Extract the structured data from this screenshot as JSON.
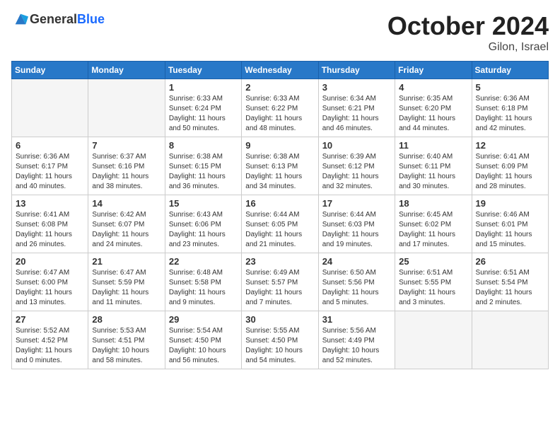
{
  "logo": {
    "general": "General",
    "blue": "Blue"
  },
  "title": "October 2024",
  "location": "Gilon, Israel",
  "days_of_week": [
    "Sunday",
    "Monday",
    "Tuesday",
    "Wednesday",
    "Thursday",
    "Friday",
    "Saturday"
  ],
  "weeks": [
    [
      {
        "day": "",
        "info": ""
      },
      {
        "day": "",
        "info": ""
      },
      {
        "day": "1",
        "sunrise": "6:33 AM",
        "sunset": "6:24 PM",
        "daylight": "11 hours and 50 minutes."
      },
      {
        "day": "2",
        "sunrise": "6:33 AM",
        "sunset": "6:22 PM",
        "daylight": "11 hours and 48 minutes."
      },
      {
        "day": "3",
        "sunrise": "6:34 AM",
        "sunset": "6:21 PM",
        "daylight": "11 hours and 46 minutes."
      },
      {
        "day": "4",
        "sunrise": "6:35 AM",
        "sunset": "6:20 PM",
        "daylight": "11 hours and 44 minutes."
      },
      {
        "day": "5",
        "sunrise": "6:36 AM",
        "sunset": "6:18 PM",
        "daylight": "11 hours and 42 minutes."
      }
    ],
    [
      {
        "day": "6",
        "sunrise": "6:36 AM",
        "sunset": "6:17 PM",
        "daylight": "11 hours and 40 minutes."
      },
      {
        "day": "7",
        "sunrise": "6:37 AM",
        "sunset": "6:16 PM",
        "daylight": "11 hours and 38 minutes."
      },
      {
        "day": "8",
        "sunrise": "6:38 AM",
        "sunset": "6:15 PM",
        "daylight": "11 hours and 36 minutes."
      },
      {
        "day": "9",
        "sunrise": "6:38 AM",
        "sunset": "6:13 PM",
        "daylight": "11 hours and 34 minutes."
      },
      {
        "day": "10",
        "sunrise": "6:39 AM",
        "sunset": "6:12 PM",
        "daylight": "11 hours and 32 minutes."
      },
      {
        "day": "11",
        "sunrise": "6:40 AM",
        "sunset": "6:11 PM",
        "daylight": "11 hours and 30 minutes."
      },
      {
        "day": "12",
        "sunrise": "6:41 AM",
        "sunset": "6:09 PM",
        "daylight": "11 hours and 28 minutes."
      }
    ],
    [
      {
        "day": "13",
        "sunrise": "6:41 AM",
        "sunset": "6:08 PM",
        "daylight": "11 hours and 26 minutes."
      },
      {
        "day": "14",
        "sunrise": "6:42 AM",
        "sunset": "6:07 PM",
        "daylight": "11 hours and 24 minutes."
      },
      {
        "day": "15",
        "sunrise": "6:43 AM",
        "sunset": "6:06 PM",
        "daylight": "11 hours and 23 minutes."
      },
      {
        "day": "16",
        "sunrise": "6:44 AM",
        "sunset": "6:05 PM",
        "daylight": "11 hours and 21 minutes."
      },
      {
        "day": "17",
        "sunrise": "6:44 AM",
        "sunset": "6:03 PM",
        "daylight": "11 hours and 19 minutes."
      },
      {
        "day": "18",
        "sunrise": "6:45 AM",
        "sunset": "6:02 PM",
        "daylight": "11 hours and 17 minutes."
      },
      {
        "day": "19",
        "sunrise": "6:46 AM",
        "sunset": "6:01 PM",
        "daylight": "11 hours and 15 minutes."
      }
    ],
    [
      {
        "day": "20",
        "sunrise": "6:47 AM",
        "sunset": "6:00 PM",
        "daylight": "11 hours and 13 minutes."
      },
      {
        "day": "21",
        "sunrise": "6:47 AM",
        "sunset": "5:59 PM",
        "daylight": "11 hours and 11 minutes."
      },
      {
        "day": "22",
        "sunrise": "6:48 AM",
        "sunset": "5:58 PM",
        "daylight": "11 hours and 9 minutes."
      },
      {
        "day": "23",
        "sunrise": "6:49 AM",
        "sunset": "5:57 PM",
        "daylight": "11 hours and 7 minutes."
      },
      {
        "day": "24",
        "sunrise": "6:50 AM",
        "sunset": "5:56 PM",
        "daylight": "11 hours and 5 minutes."
      },
      {
        "day": "25",
        "sunrise": "6:51 AM",
        "sunset": "5:55 PM",
        "daylight": "11 hours and 3 minutes."
      },
      {
        "day": "26",
        "sunrise": "6:51 AM",
        "sunset": "5:54 PM",
        "daylight": "11 hours and 2 minutes."
      }
    ],
    [
      {
        "day": "27",
        "sunrise": "5:52 AM",
        "sunset": "4:52 PM",
        "daylight": "11 hours and 0 minutes."
      },
      {
        "day": "28",
        "sunrise": "5:53 AM",
        "sunset": "4:51 PM",
        "daylight": "10 hours and 58 minutes."
      },
      {
        "day": "29",
        "sunrise": "5:54 AM",
        "sunset": "4:50 PM",
        "daylight": "10 hours and 56 minutes."
      },
      {
        "day": "30",
        "sunrise": "5:55 AM",
        "sunset": "4:50 PM",
        "daylight": "10 hours and 54 minutes."
      },
      {
        "day": "31",
        "sunrise": "5:56 AM",
        "sunset": "4:49 PM",
        "daylight": "10 hours and 52 minutes."
      },
      {
        "day": "",
        "info": ""
      },
      {
        "day": "",
        "info": ""
      }
    ]
  ]
}
